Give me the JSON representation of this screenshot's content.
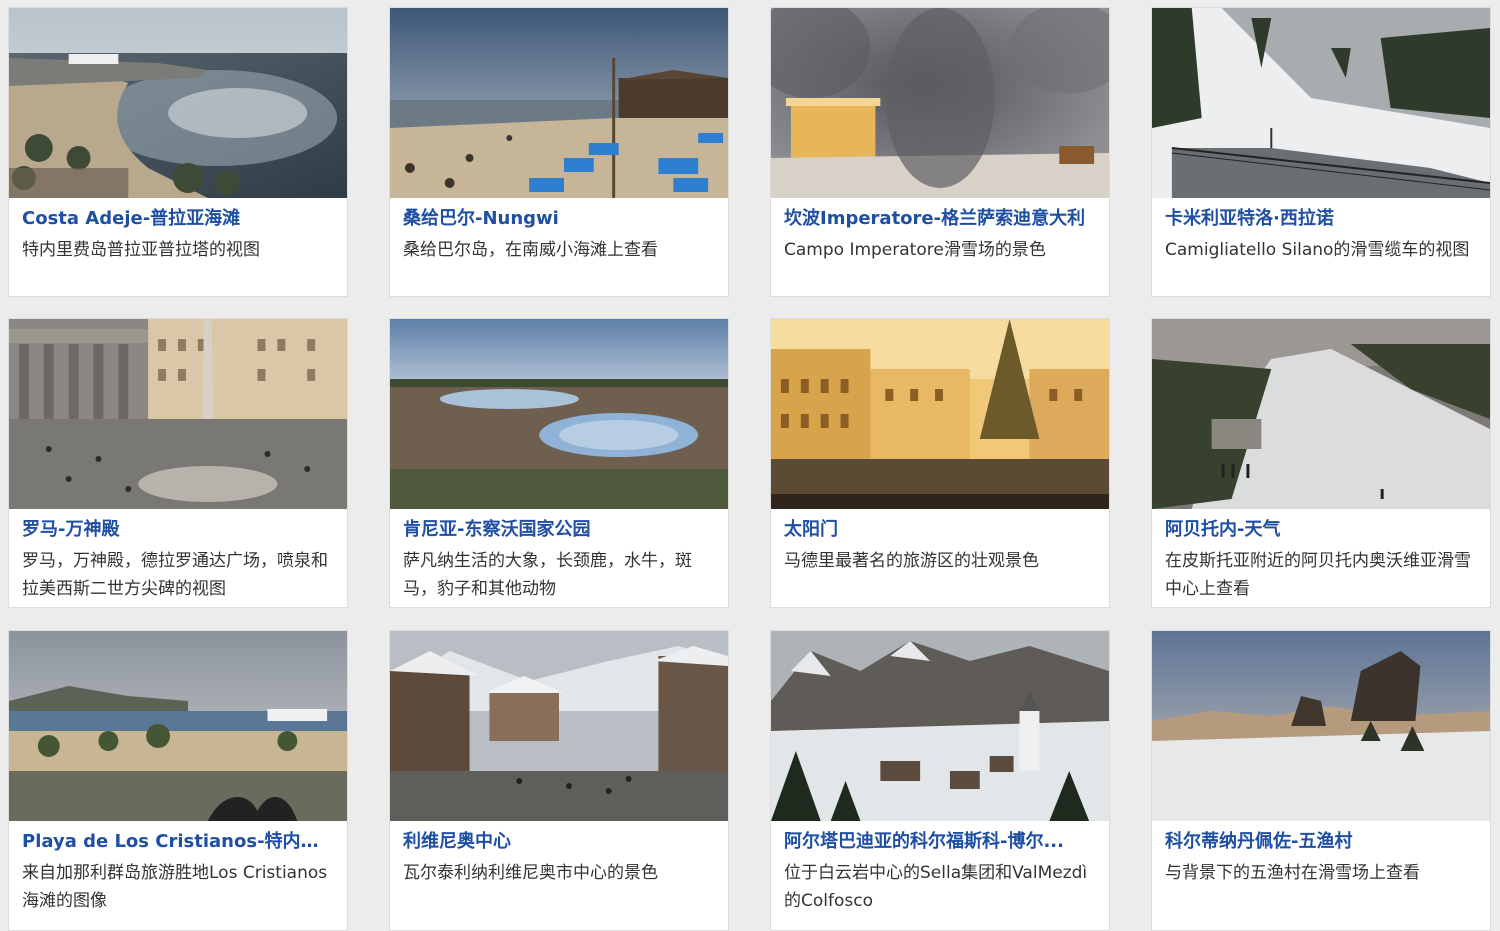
{
  "colors": {
    "title_link": "#1f4fa3",
    "description_text": "#333333",
    "page_background": "#ececec",
    "card_background": "#ffffff"
  },
  "webcams": [
    {
      "title": "Costa Adeje-普拉亚海滩",
      "description": "特内里费岛普拉亚普拉塔的视图",
      "thumbnail": "beach-harbor-scene"
    },
    {
      "title": "桑给巴尔-Nungwi",
      "description": "桑给巴尔岛，在南威小海滩上查看",
      "thumbnail": "tropical-beach-scene"
    },
    {
      "title": "坎波Imperatore-格兰萨索迪意大利",
      "description": "Campo Imperatore滑雪场的景色",
      "thumbnail": "blurred-mountain-hut-scene"
    },
    {
      "title": "卡米利亚特洛·西拉诺",
      "description": "Camigliatello Silano的滑雪缆车的视图",
      "thumbnail": "snowy-ski-slope-scene"
    },
    {
      "title": "罗马-万神殿",
      "description": "罗马，万神殿，德拉罗通达广场，喷泉和拉美西斯二世方尖碑的视图",
      "thumbnail": "pantheon-square-scene"
    },
    {
      "title": "肯尼亚-东察沃国家公园",
      "description": "萨凡纳生活的大象，长颈鹿，水牛，斑马，豹子和其他动物",
      "thumbnail": "savanna-waterhole-scene"
    },
    {
      "title": "太阳门",
      "description": "马德里最著名的旅游区的壮观景色",
      "thumbnail": "puerta-del-sol-scene"
    },
    {
      "title": "阿贝托内-天气",
      "description": "在皮斯托亚附近的阿贝托内奥沃维亚滑雪中心上查看",
      "thumbnail": "ski-center-slope-scene"
    },
    {
      "title": "Playa de Los Cristianos-特内里...",
      "description": "来自加那利群岛旅游胜地Los Cristianos海滩的图像",
      "thumbnail": "los-cristianos-beach-scene"
    },
    {
      "title": "利维尼奥中心",
      "description": "瓦尔泰利纳利维尼奥市中心的景色",
      "thumbnail": "alpine-town-street-scene"
    },
    {
      "title": "阿尔塔巴迪亚的科尔福斯科-博尔...",
      "description": "位于白云岩中心的Sella集团和ValMezdì的Colfosco",
      "thumbnail": "dolomites-village-scene"
    },
    {
      "title": "科尔蒂纳丹佩佐-五渔村",
      "description": "与背景下的五渔村在滑雪场上查看",
      "thumbnail": "cinque-torri-scene"
    }
  ]
}
